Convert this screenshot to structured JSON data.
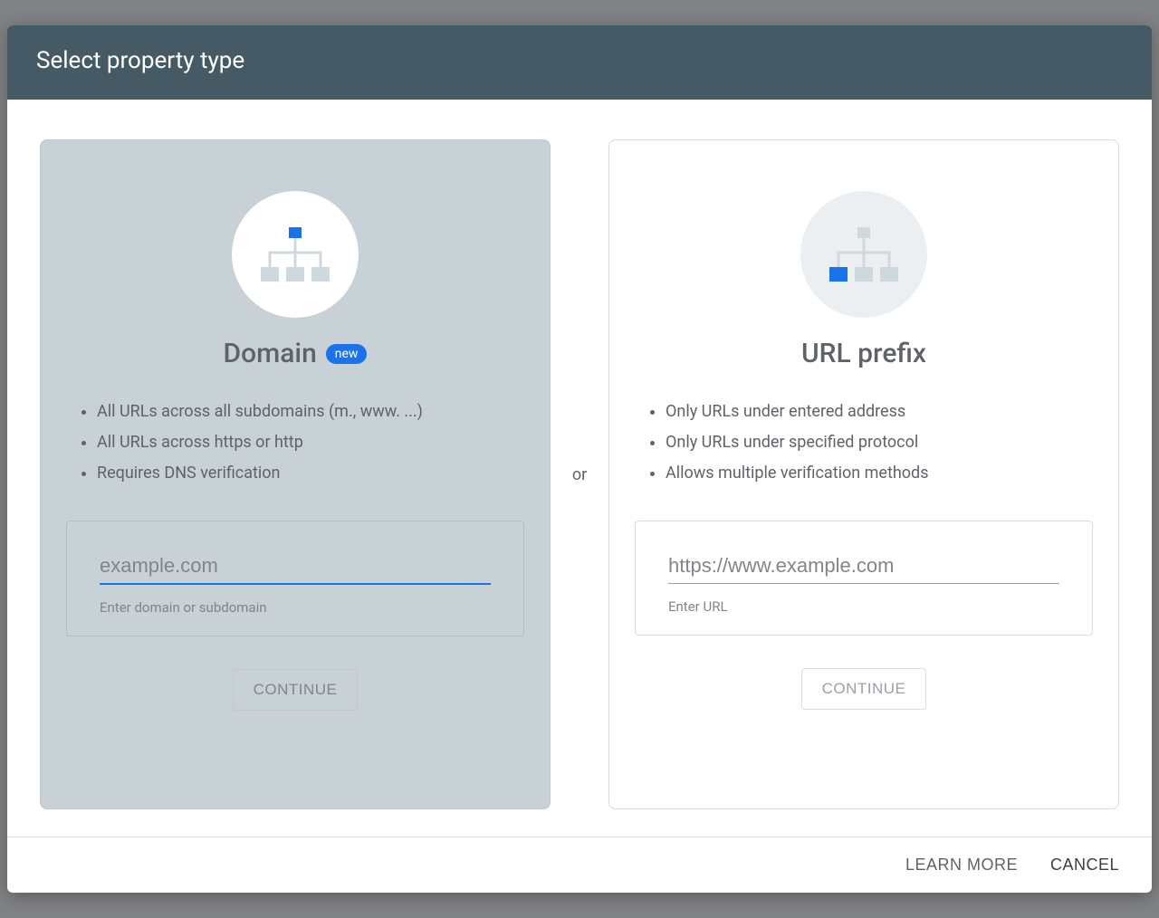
{
  "dialog": {
    "title": "Select property type",
    "divider": "or",
    "footer": {
      "learn_more": "LEARN MORE",
      "cancel": "CANCEL"
    }
  },
  "domain_card": {
    "title": "Domain",
    "badge": "new",
    "bullets": [
      "All URLs across all subdomains (m., www. ...)",
      "All URLs across https or http",
      "Requires DNS verification"
    ],
    "placeholder": "example.com",
    "hint": "Enter domain or subdomain",
    "continue": "CONTINUE"
  },
  "url_card": {
    "title": "URL prefix",
    "bullets": [
      "Only URLs under entered address",
      "Only URLs under specified protocol",
      "Allows multiple verification methods"
    ],
    "placeholder": "https://www.example.com",
    "hint": "Enter URL",
    "continue": "CONTINUE"
  }
}
